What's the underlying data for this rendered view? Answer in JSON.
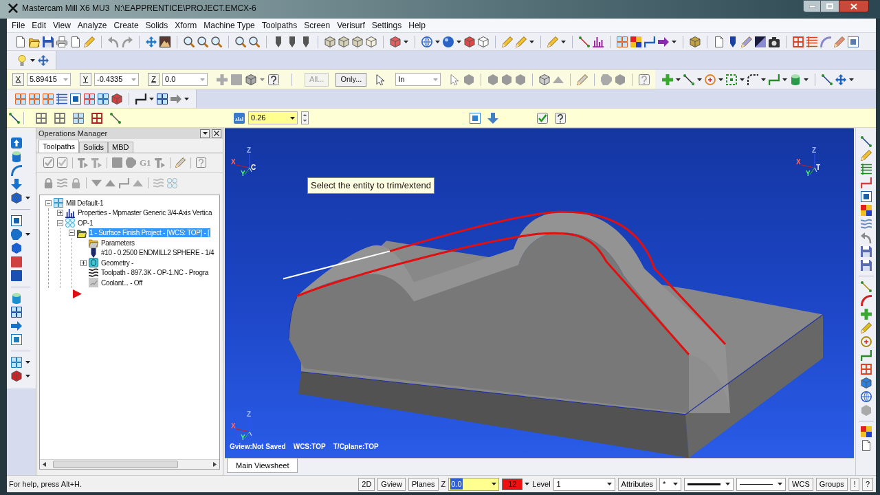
{
  "window": {
    "title": "Mastercam Mill X6 MU3  N:\\EAPPRENTICE\\PROJECT.EMCX-6"
  },
  "menu": [
    "File",
    "Edit",
    "View",
    "Analyze",
    "Create",
    "Solids",
    "Xform",
    "Machine Type",
    "Toolpaths",
    "Screen",
    "Verisurf",
    "Settings",
    "Help"
  ],
  "autocursor": {
    "fields": [
      {
        "label": "X",
        "value": "5.89415"
      },
      {
        "label": "Y",
        "value": "-0.4335"
      },
      {
        "label": "Z",
        "value": "0.0"
      }
    ],
    "buttons": [
      {
        "label": "All...",
        "disabled": true
      },
      {
        "label": "Only...",
        "disabled": false
      }
    ],
    "mode": "In"
  },
  "ribbon": {
    "value": "0.26"
  },
  "operations_manager": {
    "title": "Operations Manager",
    "tabs": [
      {
        "label": "Toolpaths",
        "selected": true
      },
      {
        "label": "Solids",
        "selected": false
      },
      {
        "label": "MBD",
        "selected": false
      }
    ],
    "toolbar_text": "G1",
    "tree": [
      {
        "kind": "machine",
        "label": "Mill Default-1",
        "expanded": true,
        "selected": false,
        "children": [
          {
            "kind": "properties",
            "label": "Properties - Mpmaster Generic 3/4-Axis Vertica",
            "expanded": false,
            "selected": false
          },
          {
            "kind": "group",
            "label": "OP-1",
            "expanded": true,
            "selected": false,
            "children": [
              {
                "kind": "operation",
                "label": "1 - Surface Finish Project - [WCS: TOP] - [",
                "expanded": true,
                "selected": true,
                "children": [
                  {
                    "kind": "parameters",
                    "label": "Parameters",
                    "selected": false
                  },
                  {
                    "kind": "tool",
                    "label": "#10 - 0.2500 ENDMILL2 SPHERE - 1/4",
                    "selected": false
                  },
                  {
                    "kind": "geometry",
                    "label": "Geometry -",
                    "expanded": false,
                    "selected": false
                  },
                  {
                    "kind": "toolpath",
                    "label": "Toolpath - 897.3K - OP-1.NC - Progra",
                    "selected": false
                  },
                  {
                    "kind": "coolant",
                    "label": "Coolant... - Off",
                    "selected": false
                  }
                ]
              }
            ]
          }
        ]
      }
    ]
  },
  "viewport": {
    "prompt": "Select the entity to trim/extend",
    "triads": [
      {
        "labels": [
          "Z",
          "X",
          "Y",
          "C"
        ]
      },
      {
        "labels": [
          "Z",
          "X",
          "Y",
          "T"
        ]
      },
      {
        "labels": [
          "Z",
          "X",
          "Y"
        ]
      }
    ],
    "status": [
      "Gview:Not Saved",
      "WCS:TOP",
      "T/Cplane:TOP"
    ],
    "sheet_tabs": [
      {
        "label": "Main Viewsheet",
        "selected": true
      }
    ]
  },
  "status_bar": {
    "help": "For help, press Alt+H.",
    "items": [
      {
        "kind": "button",
        "label": "2D"
      },
      {
        "kind": "button",
        "label": "Gview"
      },
      {
        "kind": "button",
        "label": "Planes"
      },
      {
        "kind": "label",
        "label": "Z"
      },
      {
        "kind": "field",
        "value": "0.0",
        "text_selected": true
      },
      {
        "kind": "color",
        "value": "12",
        "color": "#ee1111"
      },
      {
        "kind": "label",
        "label": "Level"
      },
      {
        "kind": "dropdown",
        "value": "1"
      },
      {
        "kind": "button",
        "label": "Attributes"
      },
      {
        "kind": "dropdown",
        "value": "*"
      },
      {
        "kind": "line_style"
      },
      {
        "kind": "line_width"
      },
      {
        "kind": "button",
        "label": "WCS"
      },
      {
        "kind": "button",
        "label": "Groups"
      },
      {
        "kind": "button",
        "label": "!"
      },
      {
        "kind": "button",
        "label": "?"
      }
    ]
  }
}
